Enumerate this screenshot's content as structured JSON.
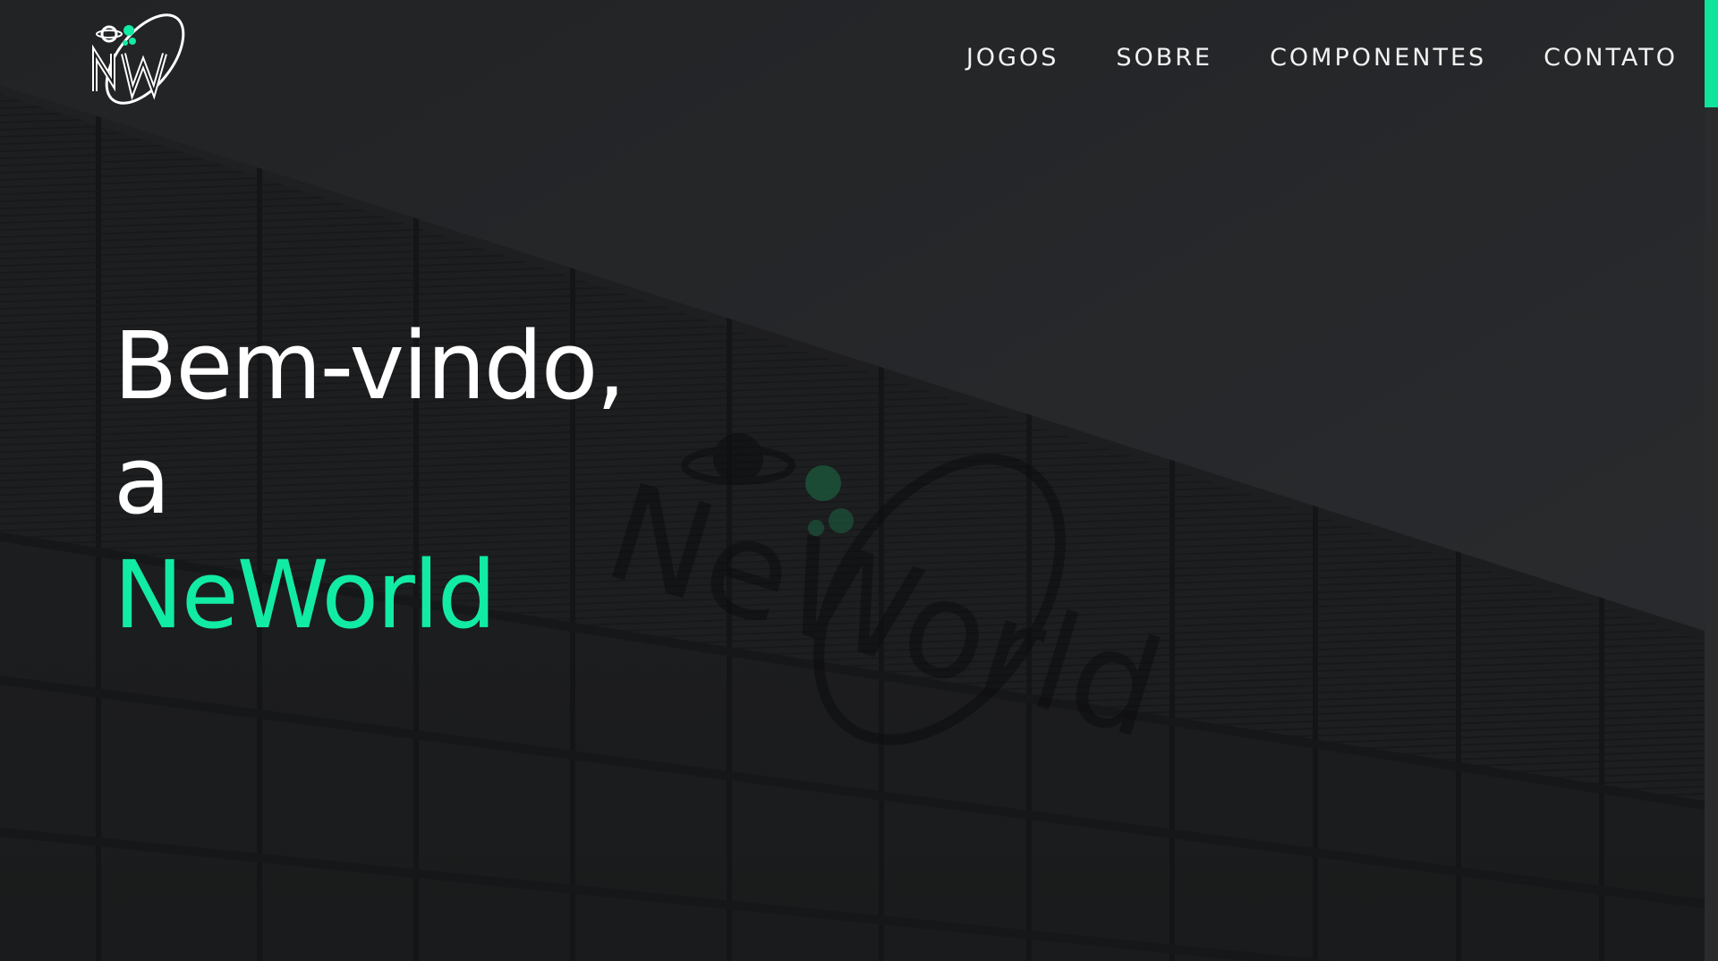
{
  "brand": {
    "logo_icon": "neworld-logo-icon",
    "accent_color": "#12eba3"
  },
  "nav": {
    "items": [
      {
        "label": "JOGOS"
      },
      {
        "label": "SOBRE"
      },
      {
        "label": "COMPONENTES"
      },
      {
        "label": "CONTATO"
      }
    ]
  },
  "hero": {
    "line1": "Bem-vindo,",
    "line2": "a",
    "line3": "NeWorld",
    "background_icon": "building-facade-with-neworld-sign"
  },
  "colors": {
    "background": "#1c1d1f",
    "text": "#ffffff",
    "accent": "#12eba3"
  }
}
